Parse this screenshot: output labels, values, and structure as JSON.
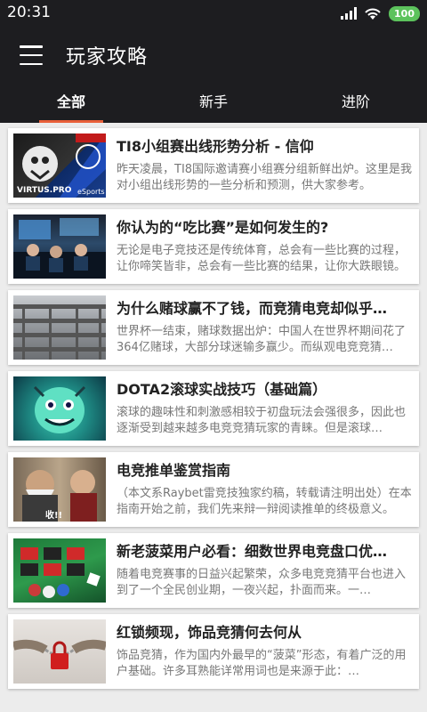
{
  "status": {
    "time": "20:31",
    "battery": "100"
  },
  "app": {
    "title": "玩家攻略"
  },
  "tabs": [
    {
      "label": "全部"
    },
    {
      "label": "新手"
    },
    {
      "label": "进阶"
    }
  ],
  "articles": [
    {
      "title": "TI8小组赛出线形势分析 - 信仰",
      "desc": "昨天凌晨，TI8国际邀请赛小组赛分组新鲜出炉。这里是我对小组出线形势的一些分析和预测，供大家参考。"
    },
    {
      "title": "你认为的“吃比赛”是如何发生的?",
      "desc": "无论是电子竞技还是传统体育，总会有一些比赛的过程，让你啼笑皆非，总会有一些比赛的结果，让你大跌眼镜。"
    },
    {
      "title": "为什么赌球赢不了钱，而竞猜电竞却似乎…",
      "desc": "世界杯一结束，赌球数据出炉：中国人在世界杯期间花了364亿赌球，大部分球迷输多赢少。而纵观电竞竞猜…"
    },
    {
      "title": "DOTA2滚球实战技巧（基础篇）",
      "desc": "滚球的趣味性和刺激感相较于初盘玩法会强很多，因此也逐渐受到越来越多电竞竞猜玩家的青睐。但是滚球…"
    },
    {
      "title": "电竞推单鉴赏指南",
      "desc": "（本文系Raybet雷竞技独家约稿，转载请注明出处）在本指南开始之前，我们先来辩一辩阅读推单的终极意义。"
    },
    {
      "title": "新老菠菜用户必看：细数世界电竞盘口优…",
      "desc": "随着电竞赛事的日益兴起繁荣，众多电竞竞猜平台也进入到了一个全民创业期，一夜兴起，扑面而来。一…"
    },
    {
      "title": "红锁频现，饰品竞猜何去何从",
      "desc": "饰品竞猜，作为国内外最早的“菠菜”形态，有着广泛的用户基础。许多耳熟能详常用词也是来源于此：…"
    }
  ],
  "thumbs": {
    "t1": {
      "logo": "VIRTUS.PRO",
      "brand": "eSports"
    },
    "t5": {
      "caption": "收!!"
    }
  }
}
